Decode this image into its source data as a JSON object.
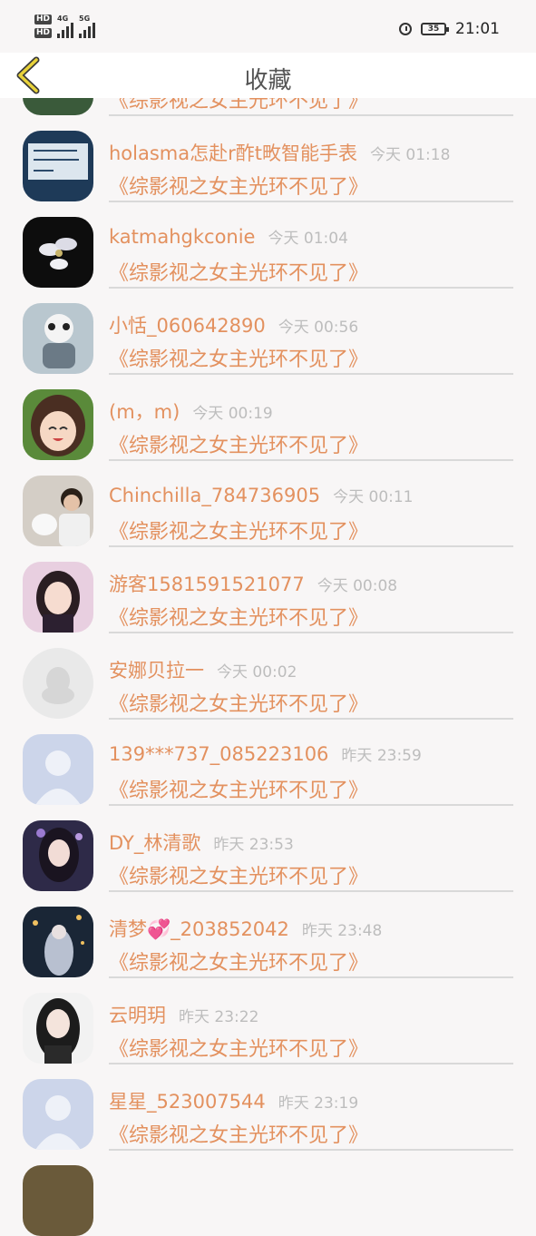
{
  "status_bar": {
    "hd1": "HD",
    "hd2": "HD",
    "net1": "4G",
    "net2": "5G",
    "battery": "35",
    "time": "21:01"
  },
  "header": {
    "title": "收藏"
  },
  "colors": {
    "accent": "#e3915f",
    "time_gray": "#bdbdbd",
    "divider": "#d9d9d9"
  },
  "list": [
    {
      "name": "",
      "time": "",
      "book": "《综影视之女主光环不见了》",
      "avatar_color": "#3a5a3a"
    },
    {
      "name": "holasma怎赴r酢t畋智能手表",
      "time": "今天 01:18",
      "book": "《综影视之女主光环不见了》",
      "avatar_color": "#2c4a6a"
    },
    {
      "name": "katmahgkconie",
      "time": "今天 01:04",
      "book": "《综影视之女主光环不见了》",
      "avatar_color": "#111111"
    },
    {
      "name": "小恬_060642890",
      "time": "今天 00:56",
      "book": "《综影视之女主光环不见了》",
      "avatar_color": "#8fa3b0"
    },
    {
      "name": "(m，m)",
      "time": "今天 00:19",
      "book": "《综影视之女主光环不见了》",
      "avatar_color": "#6b4a3a"
    },
    {
      "name": "Chinchilla_784736905",
      "time": "今天 00:11",
      "book": "《综影视之女主光环不见了》",
      "avatar_color": "#c9c2b8"
    },
    {
      "name": "游客1581591521077",
      "time": "今天 00:08",
      "book": "《综影视之女主光环不见了》",
      "avatar_color": "#d8b0c8"
    },
    {
      "name": "安娜贝拉一",
      "time": "今天 00:02",
      "book": "《综影视之女主光环不见了》",
      "avatar_color": "#e6e6e6"
    },
    {
      "name": "139***737_085223106",
      "time": "昨天 23:59",
      "book": "《综影视之女主光环不见了》",
      "avatar_color": "#cdd6ea"
    },
    {
      "name": "DY_林清歌",
      "time": "昨天 23:53",
      "book": "《综影视之女主光环不见了》",
      "avatar_color": "#3a3550"
    },
    {
      "name": "清梦💞_203852042",
      "time": "昨天 23:48",
      "book": "《综影视之女主光环不见了》",
      "avatar_color": "#1f2a3a"
    },
    {
      "name": "云明玥",
      "time": "昨天 23:22",
      "book": "《综影视之女主光环不见了》",
      "avatar_color": "#2a2a2a"
    },
    {
      "name": "星星_523007544",
      "time": "昨天 23:19",
      "book": "《综影视之女主光环不见了》",
      "avatar_color": "#cdd6ea"
    }
  ]
}
